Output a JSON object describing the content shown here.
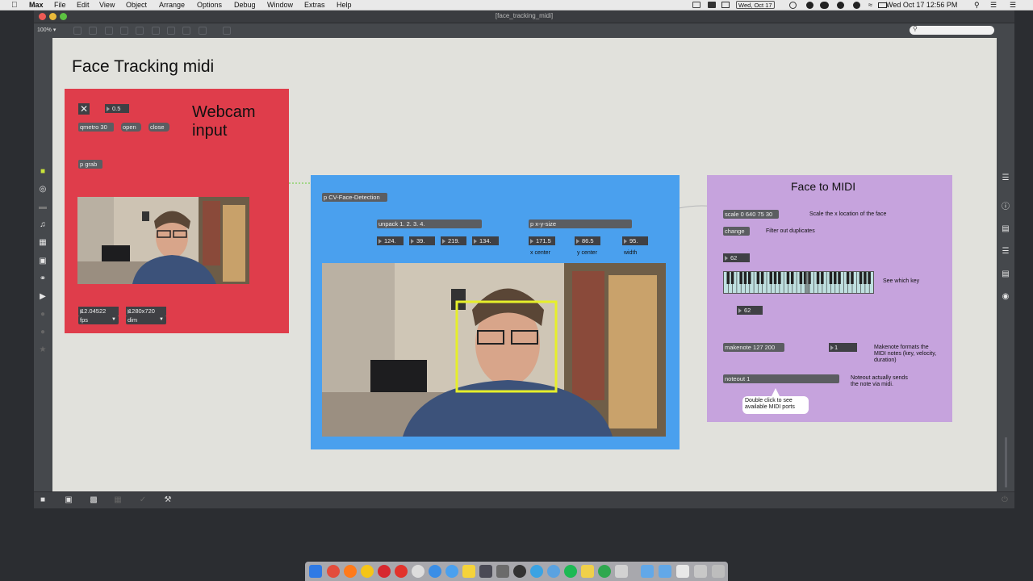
{
  "menubar": {
    "app": "Max",
    "items": [
      "File",
      "Edit",
      "View",
      "Object",
      "Arrange",
      "Options",
      "Debug",
      "Window",
      "Extras",
      "Help"
    ],
    "date_badge": "Wed, Oct 17",
    "clock": "Wed Oct 17  12:56 PM"
  },
  "window": {
    "title": "[face_tracking_midi]",
    "zoom": "100%"
  },
  "patch": {
    "title": "Face Tracking midi",
    "webcam": {
      "heading": "Webcam input",
      "toggle_value": "0.5",
      "qmetro": "qmetro 30",
      "open": "open",
      "close": "close",
      "pgrab": "p grab",
      "fps_value": "12.04522",
      "fps_menu": "fps",
      "dim_value": "1280x720",
      "dim_menu": "dim"
    },
    "cv": {
      "object": "p CV-Face-Detection",
      "unpack": "unpack 1. 2. 3. 4.",
      "xysize": "p x-y-size",
      "n1": "124.",
      "n2": "39.",
      "n3": "219.",
      "n4": "134.",
      "x": "171.5",
      "y": "86.5",
      "w": "95.",
      "label_x": "x center",
      "label_y": "y center",
      "label_w": "width"
    },
    "midi": {
      "heading": "Face to MIDI",
      "scale": "scale 0 640 75 30",
      "scale_note": "Scale the x location of the face",
      "change": "change",
      "change_note": "Filter out duplicates",
      "n1": "62",
      "keyboard_note": "See which key",
      "n2": "62",
      "makenote": "makenote 127 200",
      "one": "1",
      "makenote_note": "Makenote formats the MIDI notes (key, velocity, duration)",
      "noteout": "noteout 1",
      "noteout_note": "Noteout actually sends the note via midi.",
      "bubble": "Double click to see available MIDI ports"
    }
  },
  "colors": {
    "red_panel": "#df3d4b",
    "blue_panel": "#4aa0ee",
    "purple_panel": "#c6a3dd",
    "face_box": "#e6ef2a"
  },
  "icons": {
    "menubar": [
      "apple-icon",
      "wifi-icon",
      "battery-icon",
      "search-icon"
    ],
    "left_toolbar": [
      "cube-icon",
      "record-icon",
      "keyboard-icon",
      "note-icon",
      "sequence-icon",
      "image-icon",
      "link-icon",
      "plug-icon"
    ],
    "right_toolbar": [
      "list-icon",
      "info-icon",
      "book-icon",
      "list-icon",
      "book-icon",
      "camera-icon"
    ],
    "bottom": [
      "lock-icon",
      "presentation-icon",
      "comment-icon",
      "grid-icon",
      "wrench-icon"
    ]
  }
}
